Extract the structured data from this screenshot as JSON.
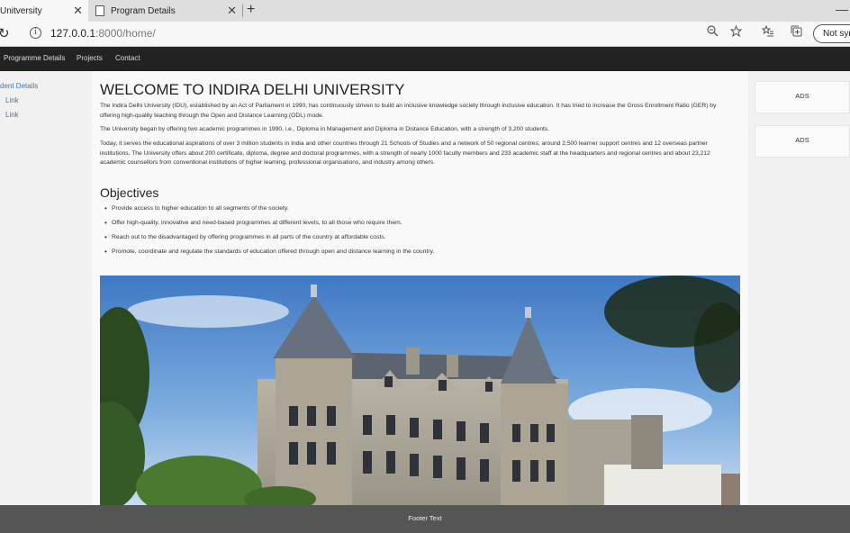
{
  "browser": {
    "active_tab_title": "Unitversity",
    "inactive_tab_title": "Program Details",
    "close_glyph": "✕",
    "new_tab_glyph": "+",
    "minimize_glyph": "—",
    "url_host": "127.0.0.1",
    "url_rest": ":8000/home/",
    "sync_label": "Not sync"
  },
  "navbar": {
    "items": [
      "Programme Details",
      "Projects",
      "Contact"
    ]
  },
  "sidebar": {
    "items": [
      "dent Details",
      "Link",
      "Link"
    ]
  },
  "main": {
    "heading": "WELCOME TO INDIRA DELHI UNIVERSITY",
    "paragraphs": [
      "The Indira Delhi University (IDU), established by an Act of Parliament in 1990, has continuously striven to build an inclusive knowledge society through inclusive education. It has tried to increase the Gross Enrollment Ratio (GER) by offering high-quality teaching through the Open and Distance Learning (ODL) mode.",
      "The University began by offering two academic programmes in 1990, i.e., Diploma in Management and Diploma in Distance Education, with a strength of 3,200 students.",
      "Today, it serves the educational aspirations of over 3 million students in India and other countries through 21 Schools of Studies and a network of 50 regional centres, around 2,500 learner support centres and 12 overseas partner institutions. The University offers about 200 certificate, diploma, degree and doctoral programmes, with a strength of nearly 1000 faculty members and 233 academic staff at the headquarters and regional centres and about 23,212 academic counsellors from conventional institutions of higher learning, professional organisations, and industry among others."
    ],
    "objectives_title": "Objectives",
    "objectives": [
      "Provide access to higher education to all segments of the society.",
      "Offer high-quality, innovative and need-based programmes at different levels, to all those who require them.",
      "Reach out to the disadvantaged by offering programmes in all parts of the country at affordable costs.",
      "Promote, coordinate and regulate the standards of education offered through open and distance learning in the country."
    ]
  },
  "ads": [
    "ADS",
    "ADS"
  ],
  "footer": {
    "text": "Footer Text"
  }
}
